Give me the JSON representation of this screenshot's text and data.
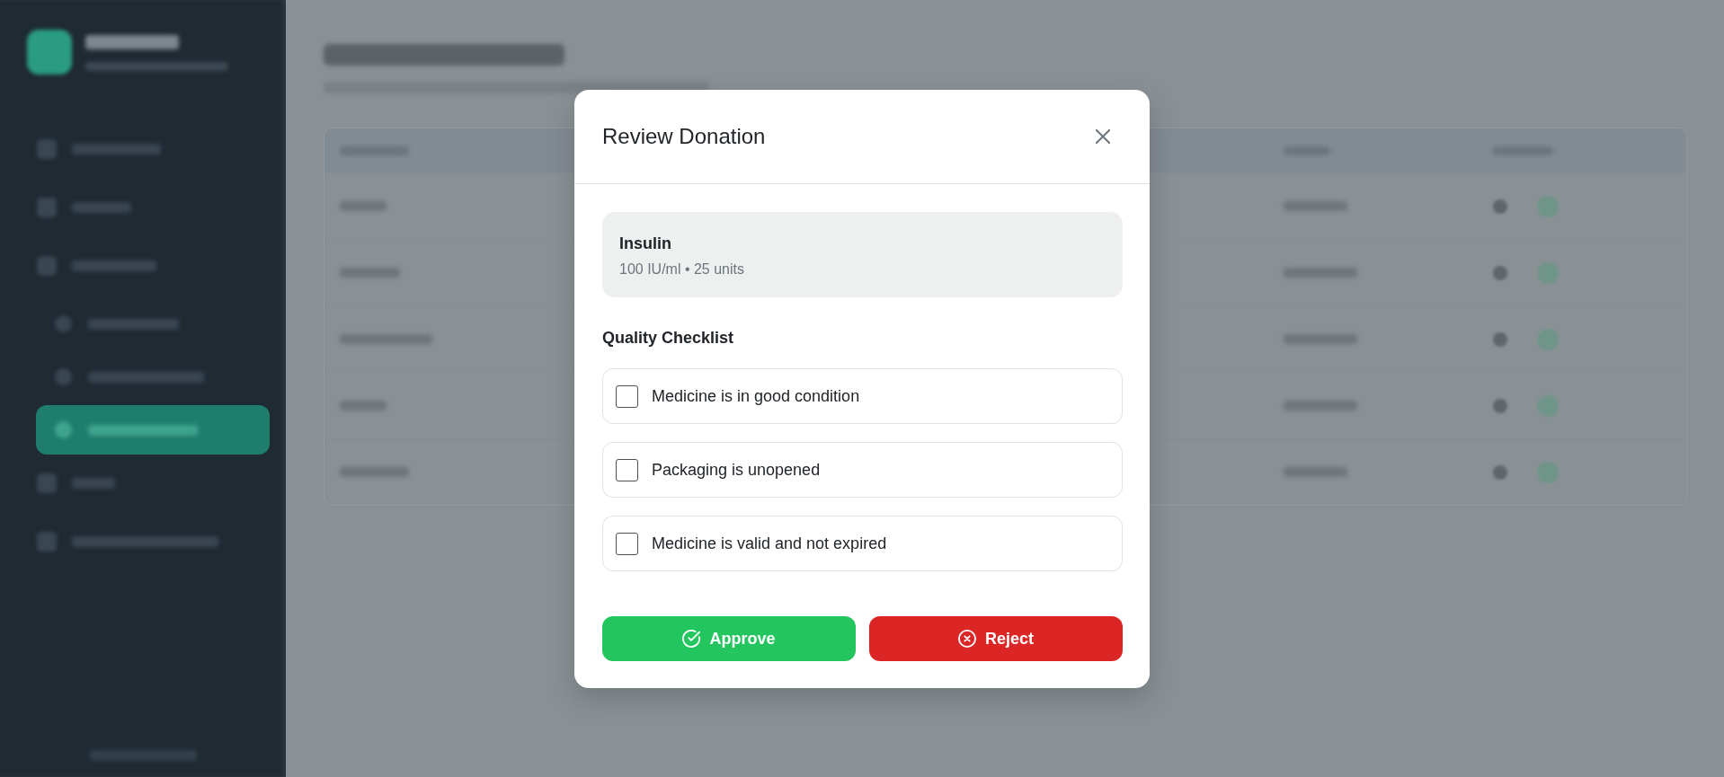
{
  "backdrop": {
    "sidebar": {
      "items": [
        {
          "kind": "main",
          "selected": false
        },
        {
          "kind": "main",
          "selected": false
        },
        {
          "kind": "main",
          "selected": false
        },
        {
          "kind": "sub",
          "selected": false
        },
        {
          "kind": "sub",
          "selected": false
        },
        {
          "kind": "sub",
          "selected": true
        },
        {
          "kind": "main",
          "selected": false
        },
        {
          "kind": "main",
          "selected": false
        }
      ]
    },
    "table": {
      "rows": [
        {
          "kind": "row"
        },
        {
          "kind": "row"
        },
        {
          "kind": "row"
        },
        {
          "kind": "row"
        },
        {
          "kind": "row"
        }
      ]
    }
  },
  "modal": {
    "title": "Review Donation",
    "item": {
      "name": "Insulin",
      "details": "100 IU/ml • 25 units"
    },
    "checklist": {
      "title": "Quality Checklist",
      "items": [
        {
          "label": "Medicine is in good condition",
          "checked": false
        },
        {
          "label": "Packaging is unopened",
          "checked": false
        },
        {
          "label": "Medicine is valid and not expired",
          "checked": false
        }
      ]
    },
    "buttons": [
      {
        "kind": "approve",
        "label": "Approve"
      },
      {
        "kind": "reject",
        "label": "Reject"
      }
    ]
  }
}
